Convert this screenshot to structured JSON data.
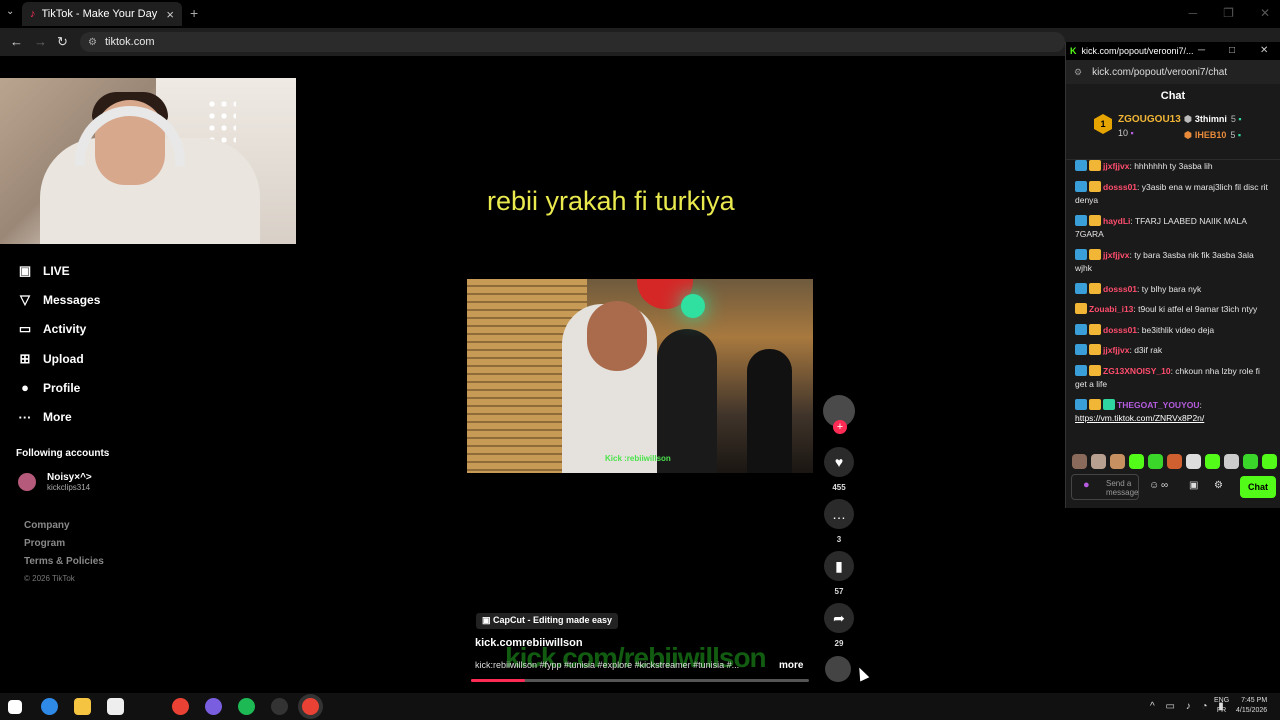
{
  "browser": {
    "tab_title": "TikTok - Make Your Day",
    "url": "tiktok.com"
  },
  "sidebar": {
    "nav": [
      {
        "label": "LIVE",
        "icon": "live-icon"
      },
      {
        "label": "Messages",
        "icon": "messages-icon"
      },
      {
        "label": "Activity",
        "icon": "activity-icon"
      },
      {
        "label": "Upload",
        "icon": "upload-icon"
      },
      {
        "label": "Profile",
        "icon": "profile-icon"
      },
      {
        "label": "More",
        "icon": "more-icon"
      }
    ],
    "following_header": "Following accounts",
    "following": [
      {
        "name": "Noisy×^>",
        "handle": "kickclips314"
      }
    ],
    "footer": [
      "Company",
      "Program",
      "Terms & Policies"
    ],
    "copyright": "© 2026 TikTok"
  },
  "video": {
    "caption": "rebii yrakah fi turkiya",
    "kick_tag": "Kick :rebiiwillson",
    "capcut": "CapCut - Editing made easy",
    "author": "kick.comrebiiwillson",
    "description": "kick:rebiiwillson #fypp #tunisia #explore #kickstreamer #tunisia #...",
    "more": "more",
    "watermark": "kick.com/rebiiwillson",
    "progress_fraction": 0.16
  },
  "actions": {
    "likes": "455",
    "comments": "3",
    "saves": "57",
    "shares": "29"
  },
  "kick": {
    "title": "kick.com/popout/verooni7/...",
    "url": "kick.com/popout/verooni7/chat",
    "chat_header": "Chat",
    "leaderboard": {
      "first": {
        "rank": "1",
        "name": "ZGOUGOU13",
        "score": "10"
      },
      "others": [
        {
          "name": "3thimni",
          "score": "5"
        },
        {
          "name": "IHEB10",
          "score": "5"
        }
      ]
    },
    "messages": [
      {
        "user": "jjxfjjvx",
        "color": "#ff4d6d",
        "text": "hhhhhhh ty 3asba lih",
        "badges": [
          "sub",
          "vip"
        ]
      },
      {
        "user": "dosss01",
        "color": "#ff4d6d",
        "text": "y3asib ena w maraj3lich fil disc rit denya",
        "badges": [
          "sub",
          "vip"
        ]
      },
      {
        "user": "haydLi",
        "color": "#ff4d6d",
        "text": "TFARJ LAABED NAIIK MALA 7GARA",
        "badges": [
          "sub",
          "vip"
        ]
      },
      {
        "user": "jjxfjjvx",
        "color": "#ff4d6d",
        "text": "ty bara 3asba nik fik 3asba 3ala wjhk",
        "badges": [
          "sub",
          "vip"
        ]
      },
      {
        "user": "dosss01",
        "color": "#ff4d6d",
        "text": "ty blhy bara nyk",
        "badges": [
          "sub",
          "vip"
        ]
      },
      {
        "user": "Zouabi_i13",
        "color": "#ff4d6d",
        "text": "t9oul ki atfel el 9amar t3ich ntyy",
        "badges": [
          "vip"
        ]
      },
      {
        "user": "dosss01",
        "color": "#ff4d6d",
        "text": "be3ithlik video deja",
        "badges": [
          "sub",
          "vip"
        ]
      },
      {
        "user": "jjxfjjvx",
        "color": "#ff4d6d",
        "text": "d3if rak",
        "badges": [
          "sub",
          "vip"
        ]
      },
      {
        "user": "ZG13XNOISY_10",
        "color": "#ff4d6d",
        "text": "chkoun nha lzby role fi get a life",
        "badges": [
          "sub",
          "vip"
        ]
      },
      {
        "user": "THEGOAT_YOUYOU",
        "color": "#b65ce0",
        "text": "https://vm.tiktok.com/ZNRVx8P2n/",
        "badges": [
          "sub",
          "vip",
          "og"
        ],
        "is_link": true
      }
    ],
    "input_placeholder": "Send a message",
    "chat_button": "Chat"
  },
  "taskbar": {
    "lang_1": "ENG",
    "lang_2": "FR",
    "time": "7:45 PM",
    "date": "4/15/2026"
  },
  "colors": {
    "tiktok_red": "#fe2c55",
    "kick_green": "#53fc18",
    "caption_yellow": "#eaea4f"
  }
}
